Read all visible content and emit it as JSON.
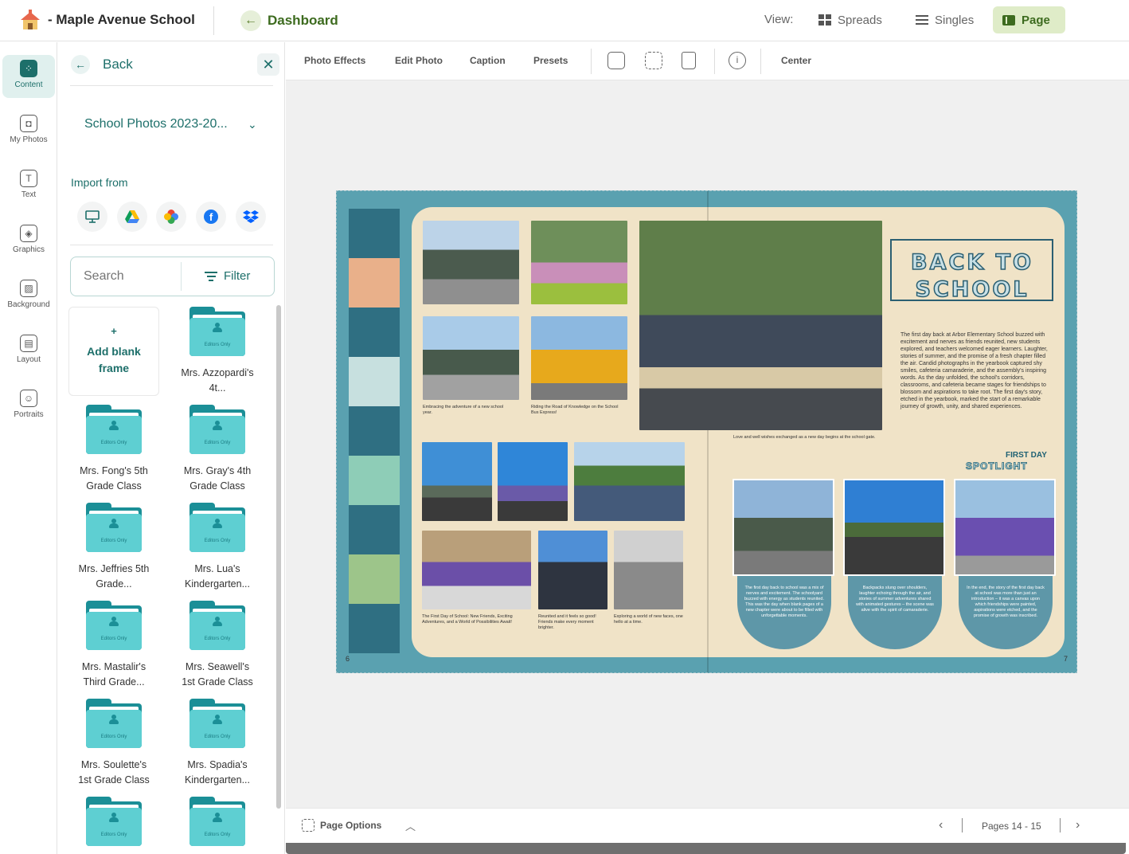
{
  "header": {
    "school_name": "- Maple Avenue School",
    "dashboard_label": "Dashboard",
    "view_label": "View:",
    "views": [
      {
        "label": "Spreads",
        "icon": "spreads-icon"
      },
      {
        "label": "Singles",
        "icon": "singles-icon"
      },
      {
        "label": "Page",
        "icon": "page-icon",
        "active": true
      }
    ]
  },
  "rail": {
    "items": [
      {
        "label": "Content",
        "icon": "content-icon",
        "active": true
      },
      {
        "label": "My Photos",
        "icon": "my-photos-icon"
      },
      {
        "label": "Text",
        "icon": "text-icon"
      },
      {
        "label": "Graphics",
        "icon": "graphics-icon"
      },
      {
        "label": "Background",
        "icon": "background-icon"
      },
      {
        "label": "Layout",
        "icon": "layout-icon"
      },
      {
        "label": "Portraits",
        "icon": "portraits-icon"
      }
    ]
  },
  "panel": {
    "back_label": "Back",
    "album": "School Photos 2023-20...",
    "import_label": "Import from",
    "import_sources": [
      "computer-icon",
      "google-drive-icon",
      "google-photos-icon",
      "facebook-icon",
      "dropbox-icon"
    ],
    "search_placeholder": "Search",
    "filter_label": "Filter",
    "add_blank": "+\nAdd blank frame",
    "add_blank_plus": "+",
    "add_blank_label": "Add blank frame",
    "folder_badge": "Editors Only",
    "folders": [
      {
        "name": "Mrs. Azzopardi's 4t..."
      },
      {
        "name": "Mrs. Fong's 5th Grade Class"
      },
      {
        "name": "Mrs. Gray's 4th Grade Class"
      },
      {
        "name": "Mrs. Jeffries 5th Grade..."
      },
      {
        "name": "Mrs. Lua's Kindergarten..."
      },
      {
        "name": "Mrs. Mastalir's Third Grade..."
      },
      {
        "name": "Mrs. Seawell's 1st Grade Class"
      },
      {
        "name": "Mrs. Soulette's 1st Grade Class"
      },
      {
        "name": "Mrs. Spadia's Kindergarten..."
      },
      {
        "name": ""
      },
      {
        "name": ""
      }
    ]
  },
  "toolbar": {
    "photo_effects": "Photo Effects",
    "edit_photo": "Edit Photo",
    "caption": "Caption",
    "presets": "Presets",
    "center": "Center"
  },
  "spread": {
    "left_page_number": "6",
    "right_page_number": "7",
    "title_line1": "BACK TO",
    "title_line2": "SCHOOL",
    "body": "The first day back at Arbor Elementary School buzzed with excitement and nerves as friends reunited, new students explored, and teachers welcomed eager learners. Laughter, stories of summer, and the promise of a fresh chapter filled the air. Candid photographs in the yearbook captured shy smiles, cafeteria camaraderie, and the assembly's inspiring words. As the day unfolded, the school's corridors, classrooms, and cafeteria became stages for friendships to blossom and aspirations to take root. The first day's story, etched in the yearbook, marked the start of a remarkable journey of growth, unity, and shared experiences.",
    "first_day": "FIRST DAY",
    "spotlight": "SPOTLIGHT",
    "captions": {
      "c1": "Embracing the adventure of a new school year.",
      "c2": "Riding the Road of Knowledge on the School Bus Express!",
      "c3": "Love and well wishes exchanged as a new day begins at the school gate.",
      "c4": "The First Day of School: New Friends, Exciting Adventures, and a World of Possibilities Await!",
      "c5": "Reunited and it feels so good! Friends make every moment brighter.",
      "c6": "Exploring a world of new faces, one hello at a time."
    },
    "arches": [
      "The first day back to school was a mix of nerves and excitement. The schoolyard buzzed with energy as students reunited. This was the day when blank pages of a new chapter were about to be filled with unforgettable moments.",
      "Backpacks slung over shoulders, laughter echoing through the air, and stories of summer adventures shared with animated gestures – the scene was alive with the spirit of camaraderie.",
      "In the end, the story of the first day back at school was more than just an introduction – it was a canvas upon which friendships were painted, aspirations were etched, and the promise of growth was inscribed."
    ]
  },
  "bottom": {
    "page_options": "Page Options",
    "pages_label": "Pages 14 - 15"
  },
  "colors": {
    "brand_green": "#3d6b1f",
    "teal": "#1d6f6a",
    "spread_blue": "#5aa1b0",
    "spread_cream": "#f0e3c7"
  }
}
